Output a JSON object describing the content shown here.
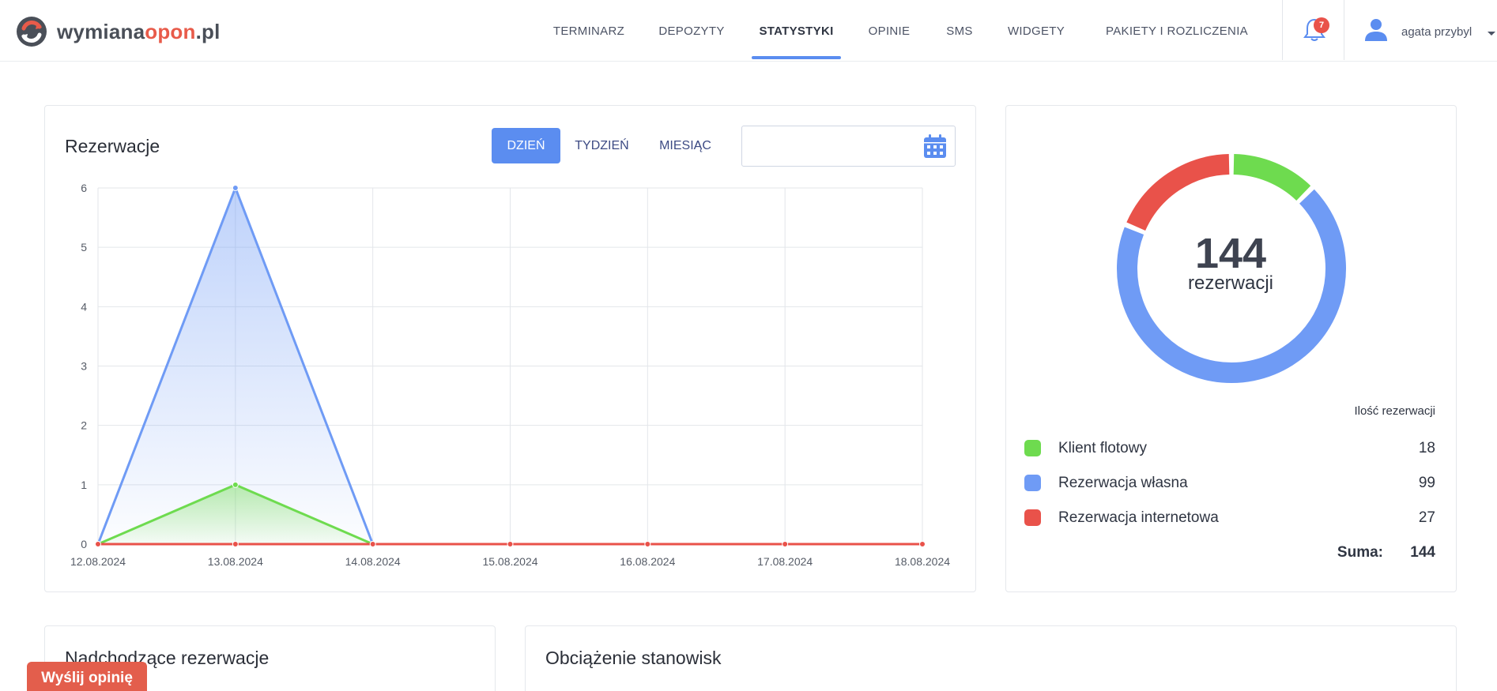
{
  "brand": {
    "part1": "wymiana",
    "part2": "opon",
    "part3": ".pl"
  },
  "nav": {
    "items": [
      {
        "label": "TERMINARZ",
        "active": false
      },
      {
        "label": "DEPOZYTY",
        "active": false
      },
      {
        "label": "STATYSTYKI",
        "active": true
      },
      {
        "label": "OPINIE",
        "active": false
      },
      {
        "label": "SMS",
        "active": false
      },
      {
        "label": "WIDGETY",
        "active": false
      },
      {
        "label": "PAKIETY I ROZLICZENIA",
        "active": false
      }
    ]
  },
  "notifications": {
    "count": "7",
    "icon": "bell-icon"
  },
  "user": {
    "name": "agata przybyl",
    "icon": "user-icon"
  },
  "colors": {
    "accent": "#5b8df0",
    "green": "#6edb4f",
    "blue": "#6f9bf5",
    "red": "#e9524a",
    "brand_red": "#e85b4a"
  },
  "reservations_card": {
    "title": "Rezerwacje",
    "periods": [
      {
        "label": "DZIEŃ",
        "active": true
      },
      {
        "label": "TYDZIEŃ",
        "active": false
      },
      {
        "label": "MIESIĄC",
        "active": false
      }
    ],
    "date_value": "",
    "date_icon": "calendar-icon"
  },
  "chart_data": [
    {
      "type": "area",
      "x": [
        "12.08.2024",
        "13.08.2024",
        "14.08.2024",
        "15.08.2024",
        "16.08.2024",
        "17.08.2024",
        "18.08.2024"
      ],
      "ylim": [
        0,
        6
      ],
      "yticks": [
        0,
        1,
        2,
        3,
        4,
        5,
        6
      ],
      "grid": true,
      "series": [
        {
          "color": "#6f9bf5",
          "values": [
            0,
            6,
            0,
            0,
            0,
            0,
            0
          ]
        },
        {
          "color": "#6edb4f",
          "values": [
            0,
            1,
            0,
            0,
            0,
            0,
            0
          ]
        },
        {
          "color": "#e9524a",
          "values": [
            0,
            0,
            0,
            0,
            0,
            0,
            0
          ]
        }
      ]
    },
    {
      "type": "pie",
      "center_value": "144",
      "center_label": "rezerwacji",
      "slices": [
        {
          "name": "Klient flotowy",
          "value": 18,
          "color": "#6edb4f"
        },
        {
          "name": "Rezerwacja własna",
          "value": 99,
          "color": "#6f9bf5"
        },
        {
          "name": "Rezerwacja internetowa",
          "value": 27,
          "color": "#e9524a"
        }
      ]
    }
  ],
  "summary": {
    "header": "Ilość rezerwacji",
    "rows": [
      {
        "label": "Klient flotowy",
        "value": "18",
        "color": "#6edb4f"
      },
      {
        "label": "Rezerwacja własna",
        "value": "99",
        "color": "#6f9bf5"
      },
      {
        "label": "Rezerwacja internetowa",
        "value": "27",
        "color": "#e9524a"
      }
    ],
    "sum_label": "Suma:",
    "sum_value": "144"
  },
  "upcoming_card": {
    "title": "Nadchodzące rezerwacje"
  },
  "load_card": {
    "title": "Obciążenie stanowisk"
  },
  "feedback_button": {
    "label": "Wyślij opinię"
  }
}
